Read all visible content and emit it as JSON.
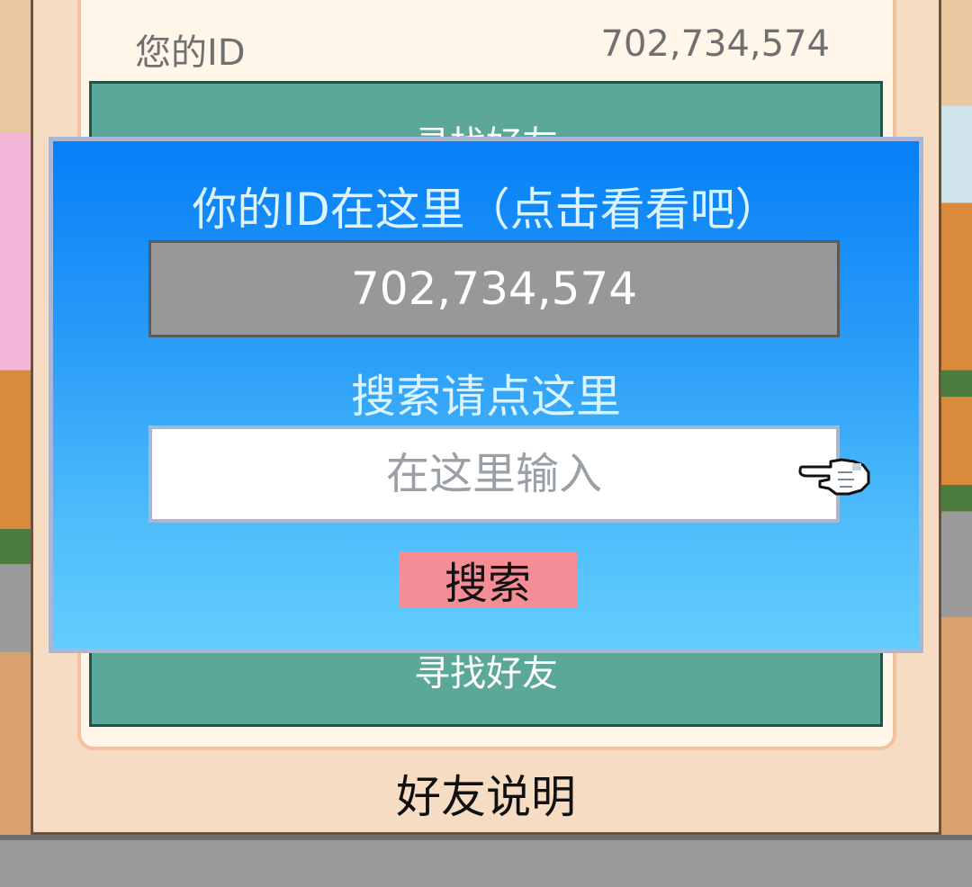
{
  "friend_card": {
    "id_label": "您的ID",
    "id_value": "702,734,574",
    "find_friends_title": "寻找好友",
    "help_button": "好友说明"
  },
  "dialog": {
    "title": "你的ID在这里（点击看看吧）",
    "id_value": "702,734,574",
    "search_label": "搜索请点这里",
    "search_placeholder": "在这里输入",
    "search_button": "搜索",
    "pointer_icon": "pointing-hand-icon"
  },
  "colors": {
    "dialog_gradient_top": "#067ff8",
    "dialog_gradient_bottom": "#62cdfd",
    "id_box": "#989898",
    "search_button": "#f58d96",
    "green_panel": "#5ca898"
  }
}
